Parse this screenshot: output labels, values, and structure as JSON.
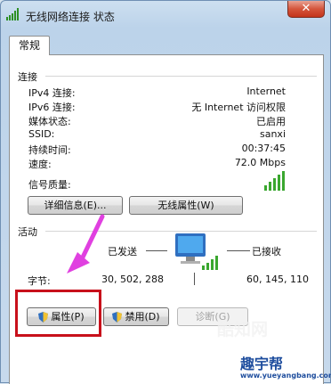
{
  "window": {
    "title": "无线网络连接 状态",
    "close_glyph": "✕"
  },
  "tabs": [
    {
      "label": "常规"
    }
  ],
  "connection": {
    "header": "连接",
    "rows": [
      {
        "label": "IPv4 连接:",
        "value": "Internet"
      },
      {
        "label": "IPv6 连接:",
        "value": "无 Internet 访问权限"
      },
      {
        "label": "媒体状态:",
        "value": "已启用"
      },
      {
        "label": "SSID:",
        "value": "sanxi"
      },
      {
        "label": "持续时间:",
        "value": "00:37:45"
      },
      {
        "label": "速度:",
        "value": "72.0 Mbps"
      }
    ],
    "signal_label": "信号质量:",
    "signal_bars": 5,
    "details_button": "详细信息(E)...",
    "wireless_props_button": "无线属性(W)"
  },
  "activity": {
    "header": "活动",
    "sent_label": "已发送",
    "received_label": "已接收",
    "bytes_label": "字节:",
    "bytes_sent": "30, 502, 288",
    "bytes_received": "60, 145, 110"
  },
  "buttons": {
    "properties": "属性(P)",
    "disable": "禁用(D)",
    "diagnose": "诊断(G)"
  },
  "watermark": {
    "brand": "酷知网",
    "brand2": "趣宇帮",
    "url": "www.yueyangbang.com"
  },
  "colors": {
    "highlight": "#c8101b",
    "arrow": "#e040e0",
    "signal": "#3aa72f"
  }
}
